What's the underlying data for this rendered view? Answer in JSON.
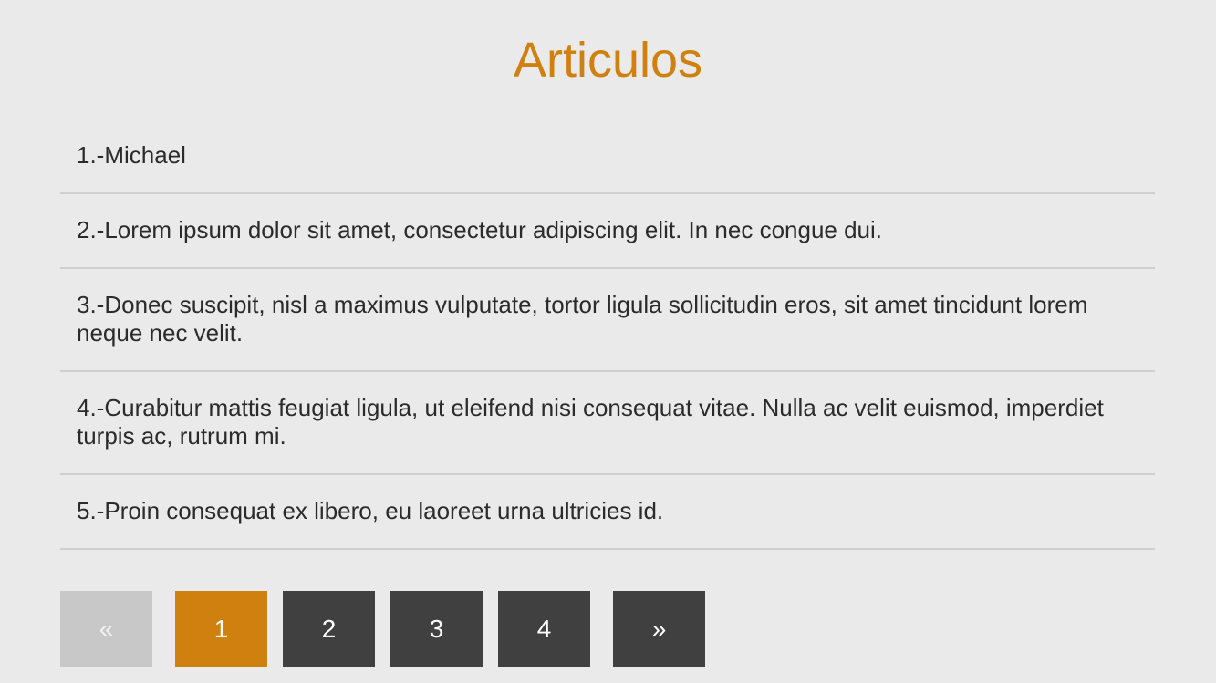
{
  "header": {
    "title": "Articulos"
  },
  "articles": [
    {
      "text": "1.-Michael"
    },
    {
      "text": "2.-Lorem ipsum dolor sit amet, consectetur adipiscing elit. In nec congue dui."
    },
    {
      "text": "3.-Donec suscipit, nisl a maximus vulputate, tortor ligula sollicitudin eros, sit amet tincidunt lorem neque nec velit."
    },
    {
      "text": "4.-Curabitur mattis feugiat ligula, ut eleifend nisi consequat vitae. Nulla ac velit euismod, imperdiet turpis ac, rutrum mi."
    },
    {
      "text": "5.-Proin consequat ex libero, eu laoreet urna ultricies id."
    }
  ],
  "pagination": {
    "prev_label": "«",
    "next_label": "»",
    "pages": [
      "1",
      "2",
      "3",
      "4"
    ],
    "current_page": "1"
  },
  "colors": {
    "accent": "#cf800f",
    "background": "#eaeaea",
    "button_dark": "#404040",
    "button_disabled": "#c8c8c8",
    "divider": "#cfcfcf"
  }
}
